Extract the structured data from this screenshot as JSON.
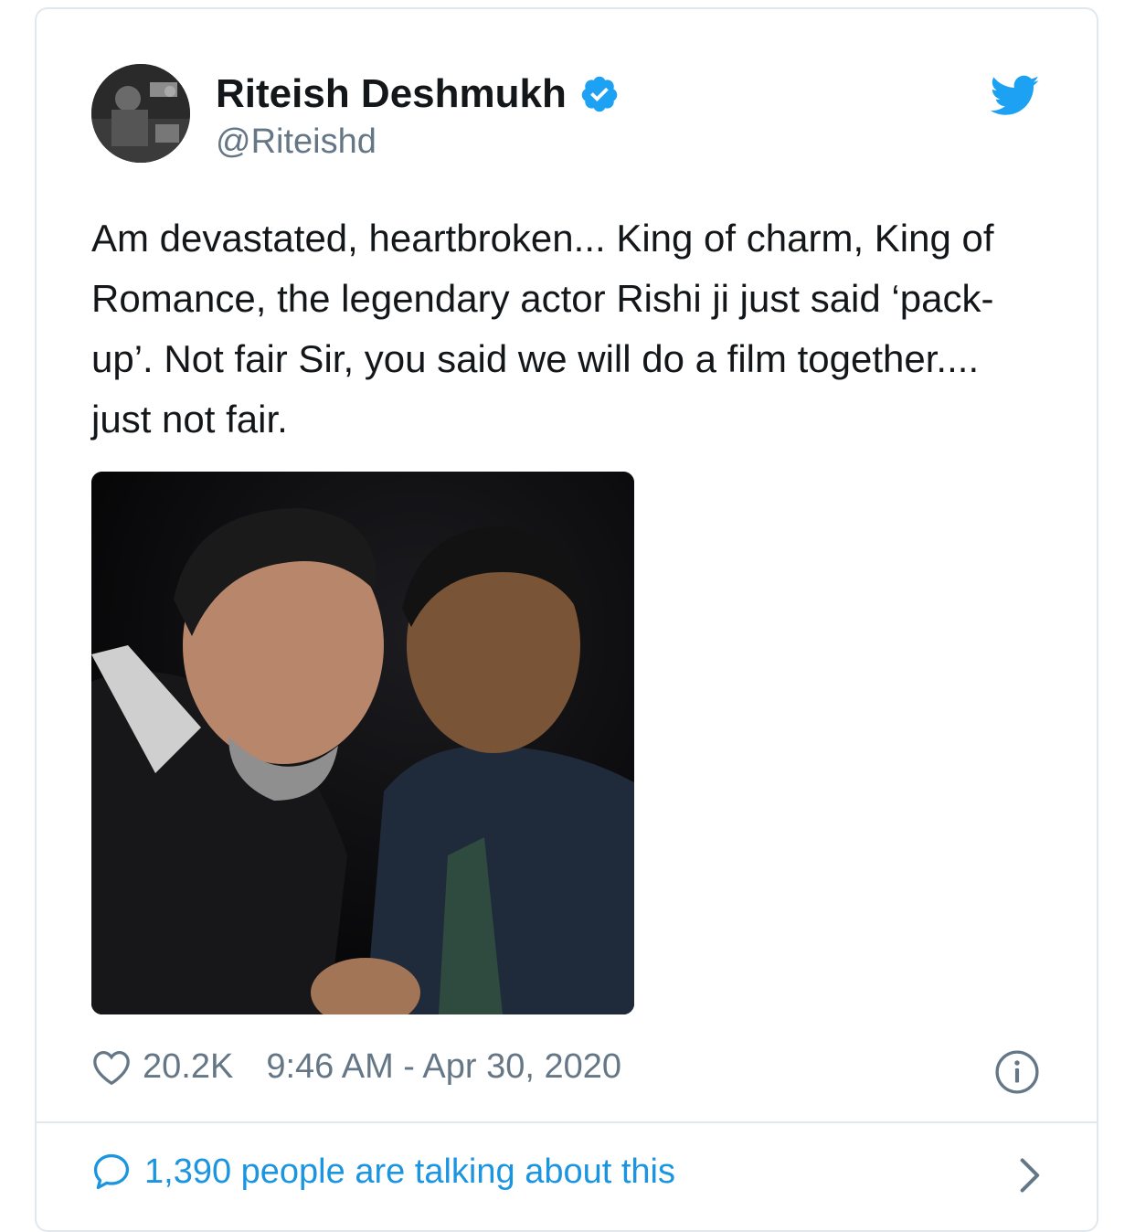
{
  "tweet": {
    "display_name": "Riteish Deshmukh",
    "handle": "@Riteishd",
    "text": "Am devastated, heartbroken... King of charm, King of Romance, the legendary actor Rishi ji just said ‘pack-up’. Not fair Sir, you said we will do a film together.... just not fair.",
    "likes": "20.2K",
    "timestamp": "9:46 AM - Apr 30, 2020",
    "talking_text": "1,390 people are talking about this"
  },
  "icons": {
    "verified": "verified-badge-icon",
    "bird": "twitter-bird-icon",
    "like": "heart-icon",
    "info": "info-icon",
    "reply": "speech-bubble-icon",
    "chevron": "chevron-right-icon"
  },
  "colors": {
    "twitter_blue": "#1da1f2",
    "link_blue": "#1b95e0",
    "muted": "#657786",
    "text": "#14171a",
    "border": "#e1e8ed"
  }
}
